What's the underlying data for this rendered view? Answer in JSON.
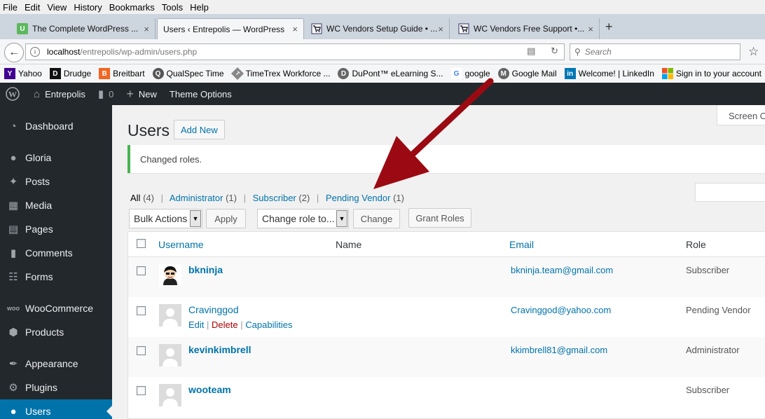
{
  "browser": {
    "menu": [
      "File",
      "Edit",
      "View",
      "History",
      "Bookmarks",
      "Tools",
      "Help"
    ],
    "tabs": [
      {
        "title": "The Complete WordPress ...",
        "close": "×",
        "fav": "U",
        "fav_color": "#5cb85c"
      },
      {
        "title": "Users ‹ Entrepolis — WordPress",
        "close": "×"
      },
      {
        "title": "WC Vendors Setup Guide • ...",
        "close": "×"
      },
      {
        "title": "WC Vendors Free Support •...",
        "close": "×"
      }
    ],
    "new_tab": "+",
    "url_host": "localhost",
    "url_path": "/entrepolis/wp-admin/users.php",
    "search_placeholder": "Search",
    "bookmarks": [
      {
        "label": "Yahoo",
        "icon": "Y",
        "color": "#400090"
      },
      {
        "label": "Drudge",
        "icon": "D",
        "color": "#111"
      },
      {
        "label": "Breitbart",
        "icon": "B",
        "color": "#f26522"
      },
      {
        "label": "QualSpec Time",
        "icon": "Q",
        "color": "#555"
      },
      {
        "label": "TimeTrex Workforce ...",
        "icon": "T",
        "color": "#888"
      },
      {
        "label": "DuPont™ eLearning S...",
        "icon": "D",
        "color": "#666"
      },
      {
        "label": "google",
        "icon": "G",
        "color": "#4285f4"
      },
      {
        "label": "Google Mail",
        "icon": "M",
        "color": "#666"
      },
      {
        "label": "Welcome! | LinkedIn",
        "icon": "in",
        "color": "#0077b5"
      },
      {
        "label": "Sign in to your account",
        "icon": "■",
        "color": "#f25022"
      }
    ]
  },
  "adminbar": {
    "site": "Entrepolis",
    "comments_count": "0",
    "new": "New",
    "theme_options": "Theme Options"
  },
  "sidebar": {
    "items": [
      {
        "label": "Dashboard",
        "icon": "dashboard-icon"
      },
      {
        "label": "Gloria",
        "icon": "gloria-icon"
      },
      {
        "label": "Posts",
        "icon": "posts-icon"
      },
      {
        "label": "Media",
        "icon": "media-icon"
      },
      {
        "label": "Pages",
        "icon": "pages-icon"
      },
      {
        "label": "Comments",
        "icon": "comments-icon"
      },
      {
        "label": "Forms",
        "icon": "forms-icon"
      },
      {
        "label": "WooCommerce",
        "icon": "woocommerce-icon"
      },
      {
        "label": "Products",
        "icon": "products-icon"
      },
      {
        "label": "Appearance",
        "icon": "appearance-icon"
      },
      {
        "label": "Plugins",
        "icon": "plugins-icon"
      },
      {
        "label": "Users",
        "icon": "users-icon"
      }
    ]
  },
  "main": {
    "screen_options": "Screen O",
    "title": "Users",
    "add_new": "Add New",
    "notice": "Changed roles.",
    "filters": {
      "all": "All",
      "all_count": "(4)",
      "admin": "Administrator",
      "admin_count": "(1)",
      "subscriber": "Subscriber",
      "subscriber_count": "(2)",
      "pending": "Pending Vendor",
      "pending_count": "(1)",
      "sep": "|"
    },
    "bulk_actions": "Bulk Actions",
    "apply": "Apply",
    "change_role": "Change role to...",
    "change": "Change",
    "grant_roles": "Grant Roles",
    "columns": {
      "username": "Username",
      "name": "Name",
      "email": "Email",
      "role": "Role"
    },
    "row_actions": {
      "edit": "Edit",
      "delete": "Delete",
      "capabilities": "Capabilities",
      "sep": "|"
    },
    "rows": [
      {
        "username": "bkninja",
        "email": "bkninja.team@gmail.com",
        "role": "Subscriber"
      },
      {
        "username": "Cravinggod",
        "email": "Cravinggod@yahoo.com",
        "role": "Pending Vendor"
      },
      {
        "username": "kevinkimbrell",
        "email": "kkimbrell81@gmail.com",
        "role": "Administrator"
      },
      {
        "username": "wooteam",
        "email": "",
        "role": "Subscriber"
      }
    ]
  },
  "colors": {
    "arrow": "#9b0a12",
    "wp_blue": "#0073aa",
    "admin_dark": "#23282d"
  }
}
